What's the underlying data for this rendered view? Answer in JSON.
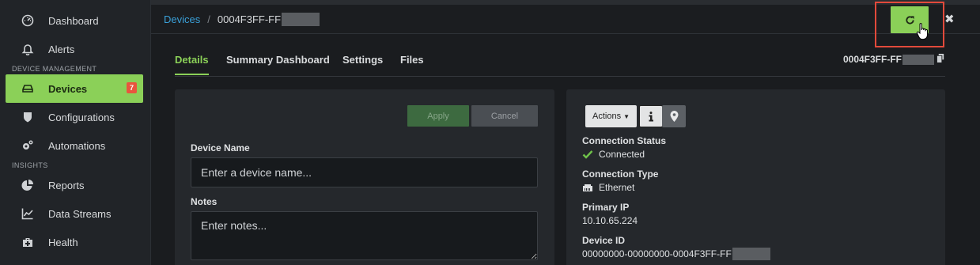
{
  "sidebar": {
    "items": [
      {
        "label": "Dashboard",
        "icon": "gauge-icon"
      },
      {
        "label": "Alerts",
        "icon": "bell-icon"
      },
      {
        "section": "DEVICE MANAGEMENT"
      },
      {
        "label": "Devices",
        "icon": "router-icon",
        "badge": "7",
        "active": true
      },
      {
        "label": "Configurations",
        "icon": "shield-icon"
      },
      {
        "label": "Automations",
        "icon": "gears-icon"
      },
      {
        "section": "INSIGHTS"
      },
      {
        "label": "Reports",
        "icon": "pie-chart-icon"
      },
      {
        "label": "Data Streams",
        "icon": "line-chart-icon"
      },
      {
        "label": "Health",
        "icon": "medkit-icon"
      }
    ]
  },
  "header": {
    "breadcrumb_root": "Devices",
    "breadcrumb_sep": "/",
    "breadcrumb_current": "0004F3FF-FF",
    "close_glyph": "✖"
  },
  "tabs": [
    {
      "label": "Details",
      "active": true
    },
    {
      "label": "Summary Dashboard"
    },
    {
      "label": "Settings"
    },
    {
      "label": "Files"
    }
  ],
  "device_id_short": "0004F3FF-FF",
  "form": {
    "apply_label": "Apply",
    "cancel_label": "Cancel",
    "device_name_label": "Device Name",
    "device_name_placeholder": "Enter a device name...",
    "device_name_value": "",
    "notes_label": "Notes",
    "notes_placeholder": "Enter notes...",
    "notes_value": ""
  },
  "info": {
    "actions_label": "Actions",
    "connection_status_label": "Connection Status",
    "connection_status_value": "Connected",
    "connection_type_label": "Connection Type",
    "connection_type_value": "Ethernet",
    "primary_ip_label": "Primary IP",
    "primary_ip_value": "10.10.65.224",
    "device_id_label": "Device ID",
    "device_id_value": "00000000-00000000-0004F3FF-FF"
  },
  "colors": {
    "accent": "#8bd058",
    "link": "#3aa0d8",
    "badge": "#e8553e",
    "highlight": "#e24a3b"
  }
}
